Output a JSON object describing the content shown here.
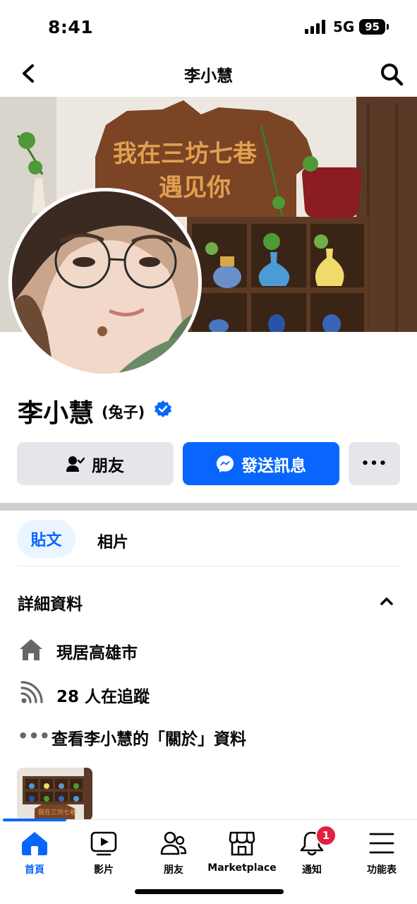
{
  "status_bar": {
    "time": "8:41",
    "network": "5G",
    "battery": "95"
  },
  "nav": {
    "title": "李小慧"
  },
  "cover": {
    "sign_line1": "我在三坊七巷",
    "sign_line2": "遇见你"
  },
  "profile": {
    "name": "李小慧",
    "nickname": "(兔子)"
  },
  "actions": {
    "friends_label": "朋友",
    "message_label": "發送訊息",
    "more_label": "•••"
  },
  "tabs": {
    "posts": "貼文",
    "photos": "相片"
  },
  "details": {
    "title": "詳細資料",
    "lives_in": "現居高雄市",
    "followers": "28 人在追蹤",
    "about_link": "查看李小慧的「關於」資料",
    "more_glyph": "•••"
  },
  "thumbnail": {
    "sign_text": "我在三坊七巷"
  },
  "bottom_nav": {
    "items": [
      {
        "label": "首頁"
      },
      {
        "label": "影片"
      },
      {
        "label": "朋友"
      },
      {
        "label": "Marketplace"
      },
      {
        "label": "通知"
      },
      {
        "label": "功能表"
      }
    ],
    "notification_count": "1"
  },
  "colors": {
    "accent": "#0866ff",
    "badge": "#e41e3f",
    "button_gray": "#e4e6eb",
    "secondary_text": "#65676b"
  }
}
